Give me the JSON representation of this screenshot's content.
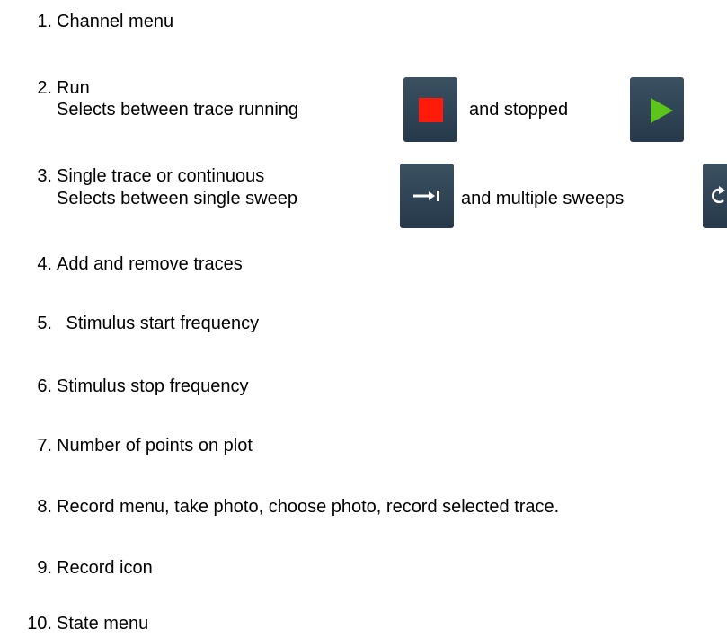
{
  "items": [
    {
      "num": "1.",
      "text": "Channel menu"
    },
    {
      "num": "2.",
      "text": "Run",
      "sub": "Selects between trace running",
      "mid": "and stopped"
    },
    {
      "num": "3.",
      "text": "Single trace or continuous",
      "sub": "Selects between single sweep",
      "mid": "and multiple sweeps"
    },
    {
      "num": "4.",
      "text": "Add and remove traces"
    },
    {
      "num": "5.",
      "text": " Stimulus start frequency"
    },
    {
      "num": "6.",
      "text": "Stimulus stop frequency"
    },
    {
      "num": "7.",
      "text": "Number of points on plot"
    },
    {
      "num": "8.",
      "text": "Record menu, take photo, choose photo, record selected trace."
    },
    {
      "num": "9.",
      "text": "Record icon"
    },
    {
      "num": "10.",
      "text": "State menu"
    }
  ],
  "icons": {
    "stop": "stop-square-icon",
    "play": "play-triangle-icon",
    "single": "single-sweep-arrow-icon",
    "continuous": "continuous-sweep-loop-icon"
  },
  "colors": {
    "button_bg": "#2f4556",
    "stop_red": "#ff1a0a",
    "play_green": "#5cc41a",
    "glyph_white": "#ffffff"
  }
}
